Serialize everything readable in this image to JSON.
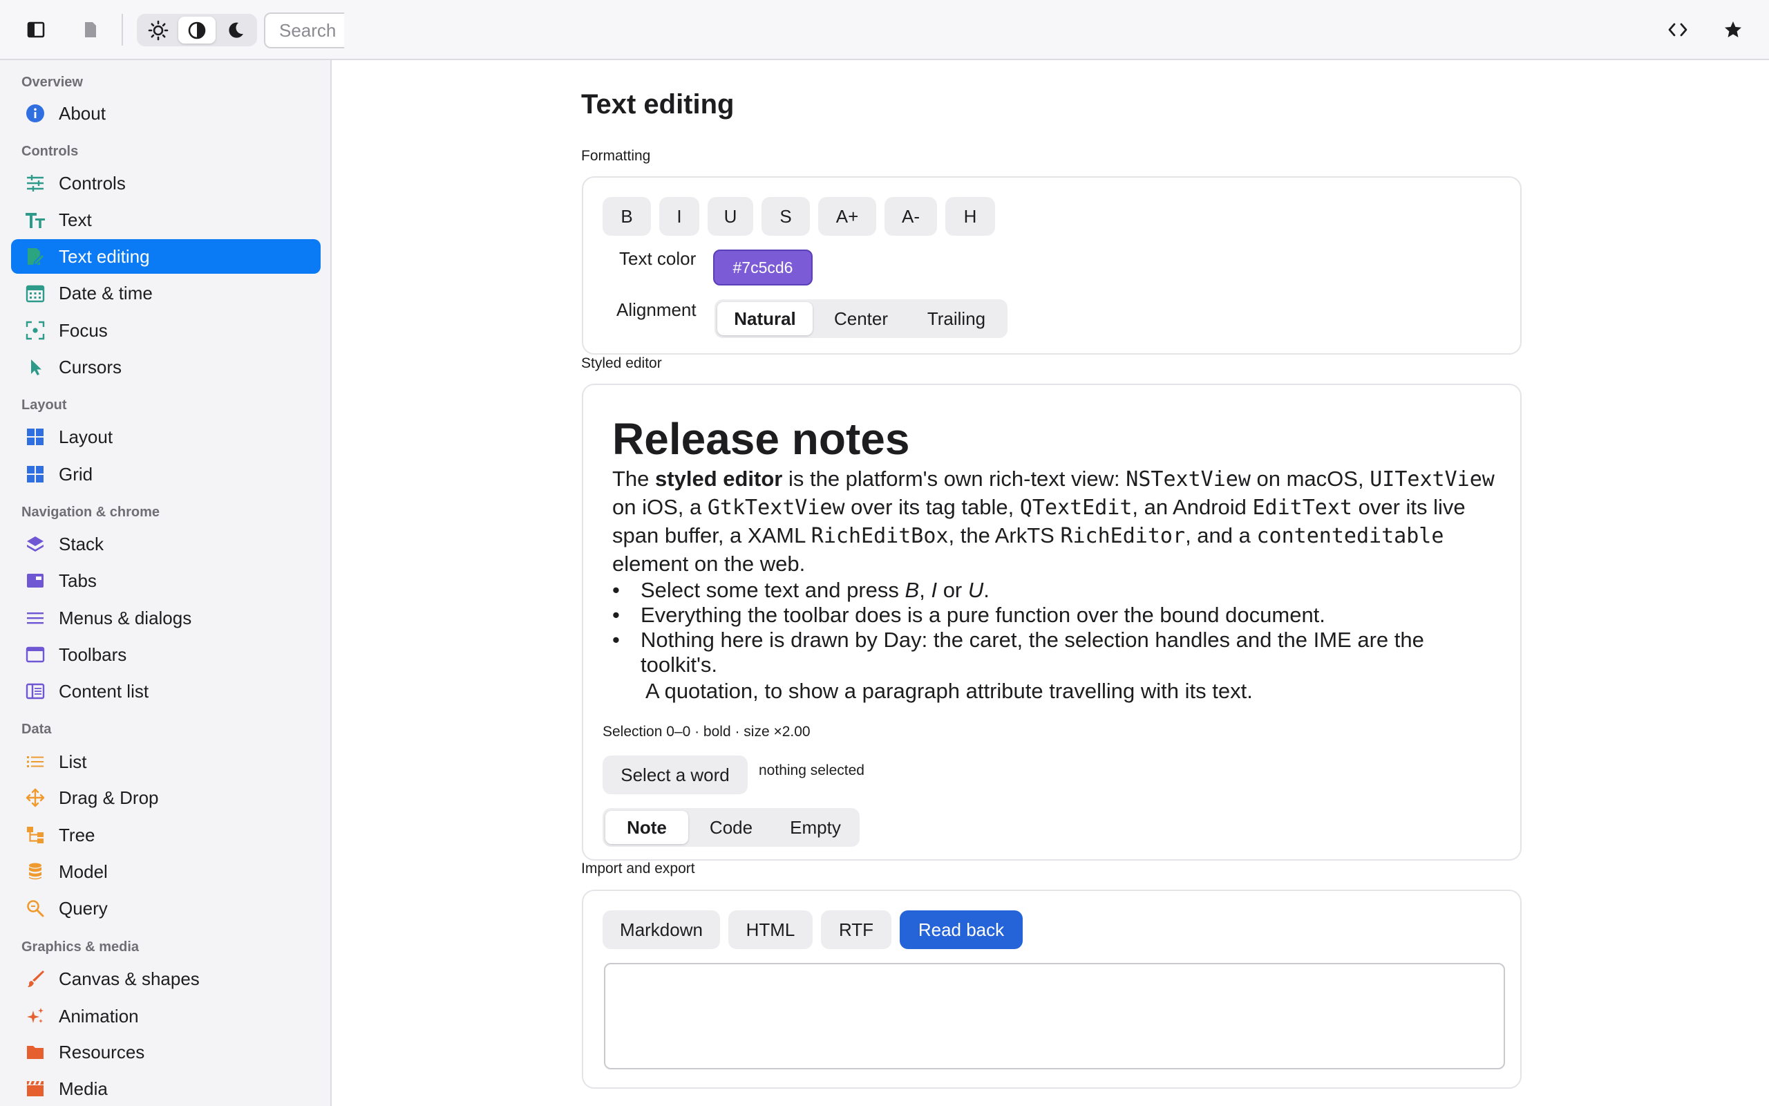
{
  "toolbar": {
    "search_placeholder": "Search",
    "icons": [
      "sidebar-toggle-icon",
      "document-icon",
      "sun-icon",
      "contrast-icon",
      "moon-icon",
      "code-icon",
      "star-icon"
    ]
  },
  "sidebar": {
    "sections": [
      {
        "title": "Overview",
        "items": [
          {
            "label": "About",
            "icon": "info-icon"
          }
        ]
      },
      {
        "title": "Controls",
        "items": [
          {
            "label": "Controls",
            "icon": "sliders-icon"
          },
          {
            "label": "Text",
            "icon": "text-size-icon"
          },
          {
            "label": "Text editing",
            "icon": "edit-document-icon",
            "active": true
          },
          {
            "label": "Date & time",
            "icon": "calendar-icon"
          },
          {
            "label": "Focus",
            "icon": "focus-icon"
          },
          {
            "label": "Cursors",
            "icon": "cursor-icon"
          }
        ]
      },
      {
        "title": "Layout",
        "items": [
          {
            "label": "Layout",
            "icon": "layout-grid-icon"
          },
          {
            "label": "Grid",
            "icon": "grid-icon"
          }
        ]
      },
      {
        "title": "Navigation & chrome",
        "items": [
          {
            "label": "Stack",
            "icon": "layers-icon"
          },
          {
            "label": "Tabs",
            "icon": "tabs-icon"
          },
          {
            "label": "Menus & dialogs",
            "icon": "menu-icon"
          },
          {
            "label": "Toolbars",
            "icon": "window-icon"
          },
          {
            "label": "Content list",
            "icon": "columns-icon"
          }
        ]
      },
      {
        "title": "Data",
        "items": [
          {
            "label": "List",
            "icon": "list-icon"
          },
          {
            "label": "Drag & Drop",
            "icon": "move-icon"
          },
          {
            "label": "Tree",
            "icon": "tree-icon"
          },
          {
            "label": "Model",
            "icon": "database-icon"
          },
          {
            "label": "Query",
            "icon": "search-icon"
          }
        ]
      },
      {
        "title": "Graphics & media",
        "items": [
          {
            "label": "Canvas & shapes",
            "icon": "brush-icon"
          },
          {
            "label": "Animation",
            "icon": "sparkles-icon"
          },
          {
            "label": "Resources",
            "icon": "folder-icon"
          },
          {
            "label": "Media",
            "icon": "film-icon"
          }
        ]
      }
    ]
  },
  "main": {
    "title": "Text editing",
    "formatting": {
      "label": "Formatting",
      "buttons": [
        "B",
        "I",
        "U",
        "S",
        "A+",
        "A-",
        "H"
      ],
      "text_color_label": "Text color",
      "text_color_value": "#7c5cd6",
      "alignment_label": "Alignment",
      "alignment_options": [
        "Natural",
        "Center",
        "Trailing"
      ],
      "alignment_selected": "Natural"
    },
    "styled_editor": {
      "label": "Styled editor",
      "heading": "Release notes",
      "p_1": "The ",
      "p_bold": "styled editor",
      "p_2": " is the platform's own rich-text view: ",
      "p_m1": "NSTextView",
      "p_3": " on macOS, ",
      "p_m2": "UITextView",
      "p_4": " on iOS, a ",
      "p_m3": "GtkTextView",
      "p_5": " over its tag table, ",
      "p_m4": "QTextEdit",
      "p_6": ", an Android ",
      "p_m5": "EditText",
      "p_7": " over its live span buffer, a XAML ",
      "p_m6": "RichEditBox",
      "p_8": ", the ArkTS ",
      "p_m7": "RichEditor",
      "p_9": ", and a ",
      "p_m8": "contenteditable",
      "p_10": " element on the web.",
      "li1_a": "Select some text and press ",
      "li1_b": "B",
      "li1_c": ", ",
      "li1_d": "I",
      "li1_e": " or ",
      "li1_f": "U",
      "li1_g": ".",
      "li2": "Everything the toolbar does is a pure function over the bound document.",
      "li3": "Nothing here is drawn by Day: the caret, the selection handles and the IME are the toolkit's.",
      "quote": "A quotation, to show a paragraph attribute travelling with its text.",
      "selection_status": "Selection 0–0 · bold · size ×2.00",
      "select_word_button": "Select a word",
      "selection_note": "nothing selected",
      "doc_options": [
        "Note",
        "Code",
        "Empty"
      ],
      "doc_selected": "Note"
    },
    "import_export": {
      "label": "Import and export",
      "buttons": [
        "Markdown",
        "HTML",
        "RTF"
      ],
      "read_back_button": "Read back",
      "output_value": ""
    }
  },
  "colors": {
    "accent": "#0a7af5",
    "primary_button": "#2563d9",
    "text_color_chip": "#7c5cd6"
  }
}
